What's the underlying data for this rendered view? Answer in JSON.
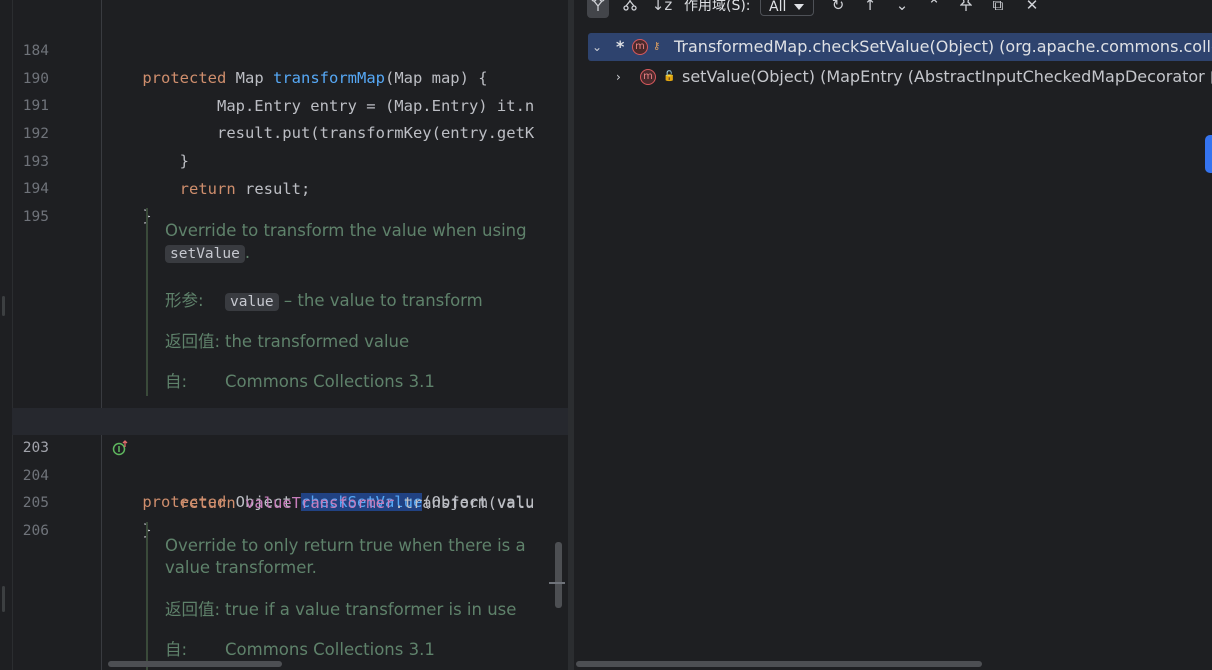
{
  "editor": {
    "lines": [
      {
        "num": "184",
        "code": [
          {
            "t": "    "
          },
          {
            "t": "protected",
            "c": "kw"
          },
          {
            "t": " Map "
          },
          {
            "t": "transformMap",
            "c": "fn"
          },
          {
            "t": "(Map map) {"
          }
        ]
      },
      {
        "num": "190",
        "code": [
          {
            "t": "            Map.Entry entry = (Map.Entry) it.n"
          }
        ]
      },
      {
        "num": "191",
        "code": [
          {
            "t": "            result.put(transformKey(entry.getK"
          }
        ]
      },
      {
        "num": "192",
        "code": [
          {
            "t": "        }"
          }
        ]
      },
      {
        "num": "193",
        "code": [
          {
            "t": "        "
          },
          {
            "t": "return",
            "c": "kw"
          },
          {
            "t": " result;"
          }
        ]
      },
      {
        "num": "194",
        "code": [
          {
            "t": "    }"
          }
        ]
      },
      {
        "num": "195",
        "code": []
      },
      {
        "num": "203",
        "code": [
          {
            "t": "    "
          },
          {
            "t": "protected",
            "c": "kw"
          },
          {
            "t": " Object "
          },
          {
            "t": "checkSetValue",
            "c": "fn sel"
          },
          {
            "t": "(Object valu"
          }
        ]
      },
      {
        "num": "204",
        "code": [
          {
            "t": "        "
          },
          {
            "t": "return",
            "c": "kw"
          },
          {
            "t": " "
          },
          {
            "t": "valueTransformer",
            "c": "fld"
          },
          {
            "t": ".transform(valu"
          }
        ]
      },
      {
        "num": "205",
        "code": [
          {
            "t": "    }"
          }
        ]
      },
      {
        "num": "206",
        "code": []
      }
    ],
    "doc1": {
      "text_before": "Override to transform the value when using",
      "code": "setValue",
      "text_after": ".",
      "param_tag": "形参:",
      "param_code": "value",
      "param_desc": "– the value to transform",
      "return_tag": "返回值:",
      "return_desc": "the transformed value",
      "since_tag": "自:",
      "since_desc": "Commons Collections 3.1"
    },
    "doc2": {
      "text": "Override to only return true when there is a value transformer.",
      "return_tag": "返回值:",
      "return_desc": "true if a value transformer is in use",
      "since_tag": "自:",
      "since_desc": "Commons Collections 3.1"
    }
  },
  "hierarchy": {
    "toolbar": {
      "scope_label": "作用域(S):",
      "scope_value": "All"
    },
    "rows": [
      {
        "prefix": "*",
        "text": "TransformedMap.checkSetValue(Object)  (org.apache.commons.collecti",
        "expanded": true,
        "selected": true
      },
      {
        "prefix": "",
        "text": "setValue(Object) (MapEntry (AbstractInputCheckedMapDecorator 内) 内",
        "expanded": false,
        "selected": false
      }
    ]
  },
  "colors": {
    "keyword": "#cf8e6d",
    "method": "#56a8f5",
    "field": "#c77dbb",
    "doc": "#5f826b",
    "selection": "#2e436e"
  },
  "icons": [
    "eye-lock-icon",
    "override-up-icon",
    "method-icon",
    "key-icon",
    "unlock-icon"
  ]
}
